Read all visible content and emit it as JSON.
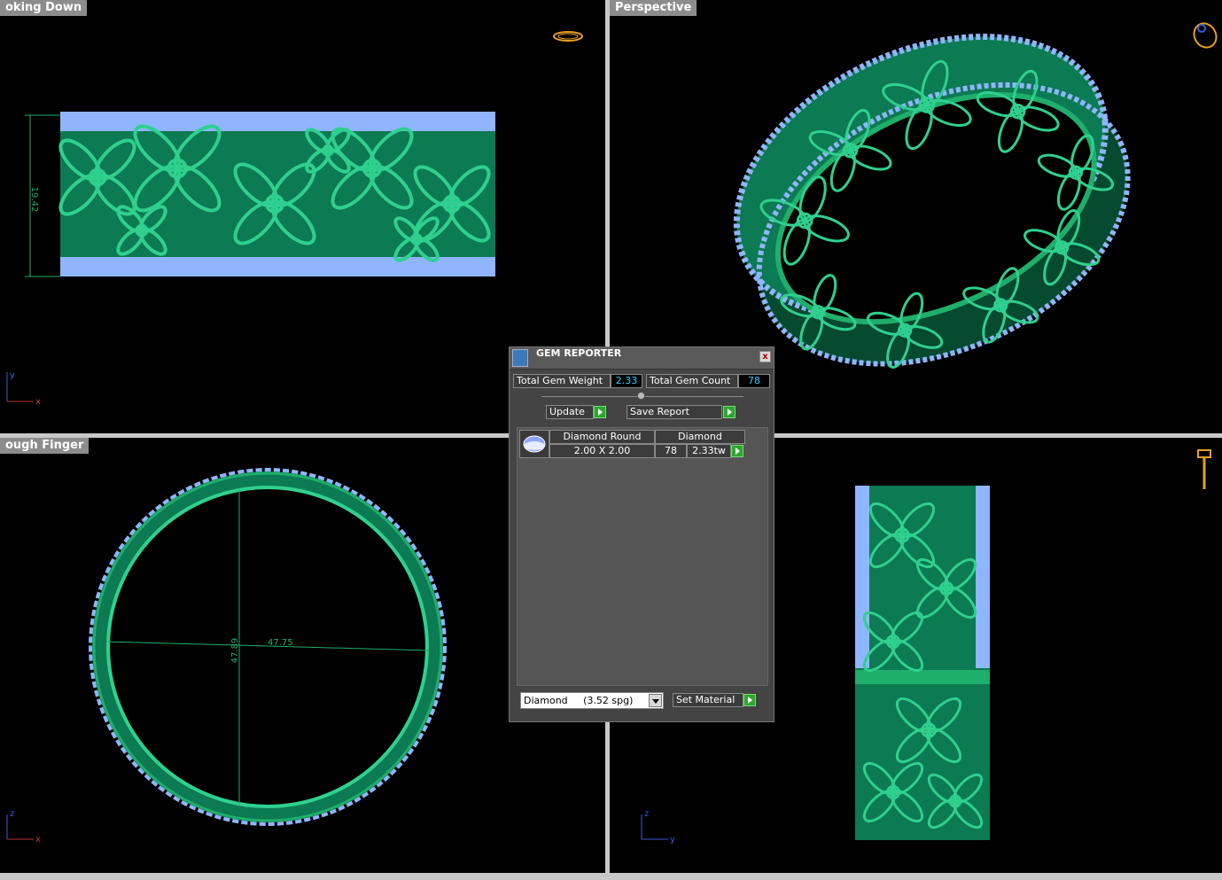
{
  "viewports": {
    "top_left": {
      "label": "oking Down",
      "dimension": "19.42",
      "axis_v": "y",
      "axis_h": "x"
    },
    "top_right": {
      "label": "Perspective"
    },
    "bottom_left": {
      "label": "ough Finger",
      "dim_horizontal": "47.75",
      "dim_vertical": "47.89",
      "axis_v": "z",
      "axis_h": "x"
    },
    "bottom_right": {
      "axis_v": "z",
      "axis_h": "y"
    }
  },
  "gem_reporter": {
    "title": "GEM REPORTER",
    "close": "x",
    "total_weight_label": "Total Gem Weight",
    "total_weight_value": "2.33",
    "total_count_label": "Total Gem Count",
    "total_count_value": "78",
    "update_label": "Update",
    "save_report_label": "Save Report",
    "table": {
      "headers": [
        "Diamond Round",
        "Diamond"
      ],
      "rows": [
        {
          "size": "2.00 X 2.00",
          "count": "78",
          "weight": "2.33tw"
        }
      ]
    },
    "material_select": "Diamond     (3.52 spg)",
    "set_material_label": "Set Material"
  },
  "colors": {
    "metal": "#0f8a5c",
    "metal_light": "#2fd08f",
    "gem": "#8fb5ff",
    "background": "#000000",
    "axis_blue": "#3a5bd8",
    "axis_red": "#c23030"
  }
}
